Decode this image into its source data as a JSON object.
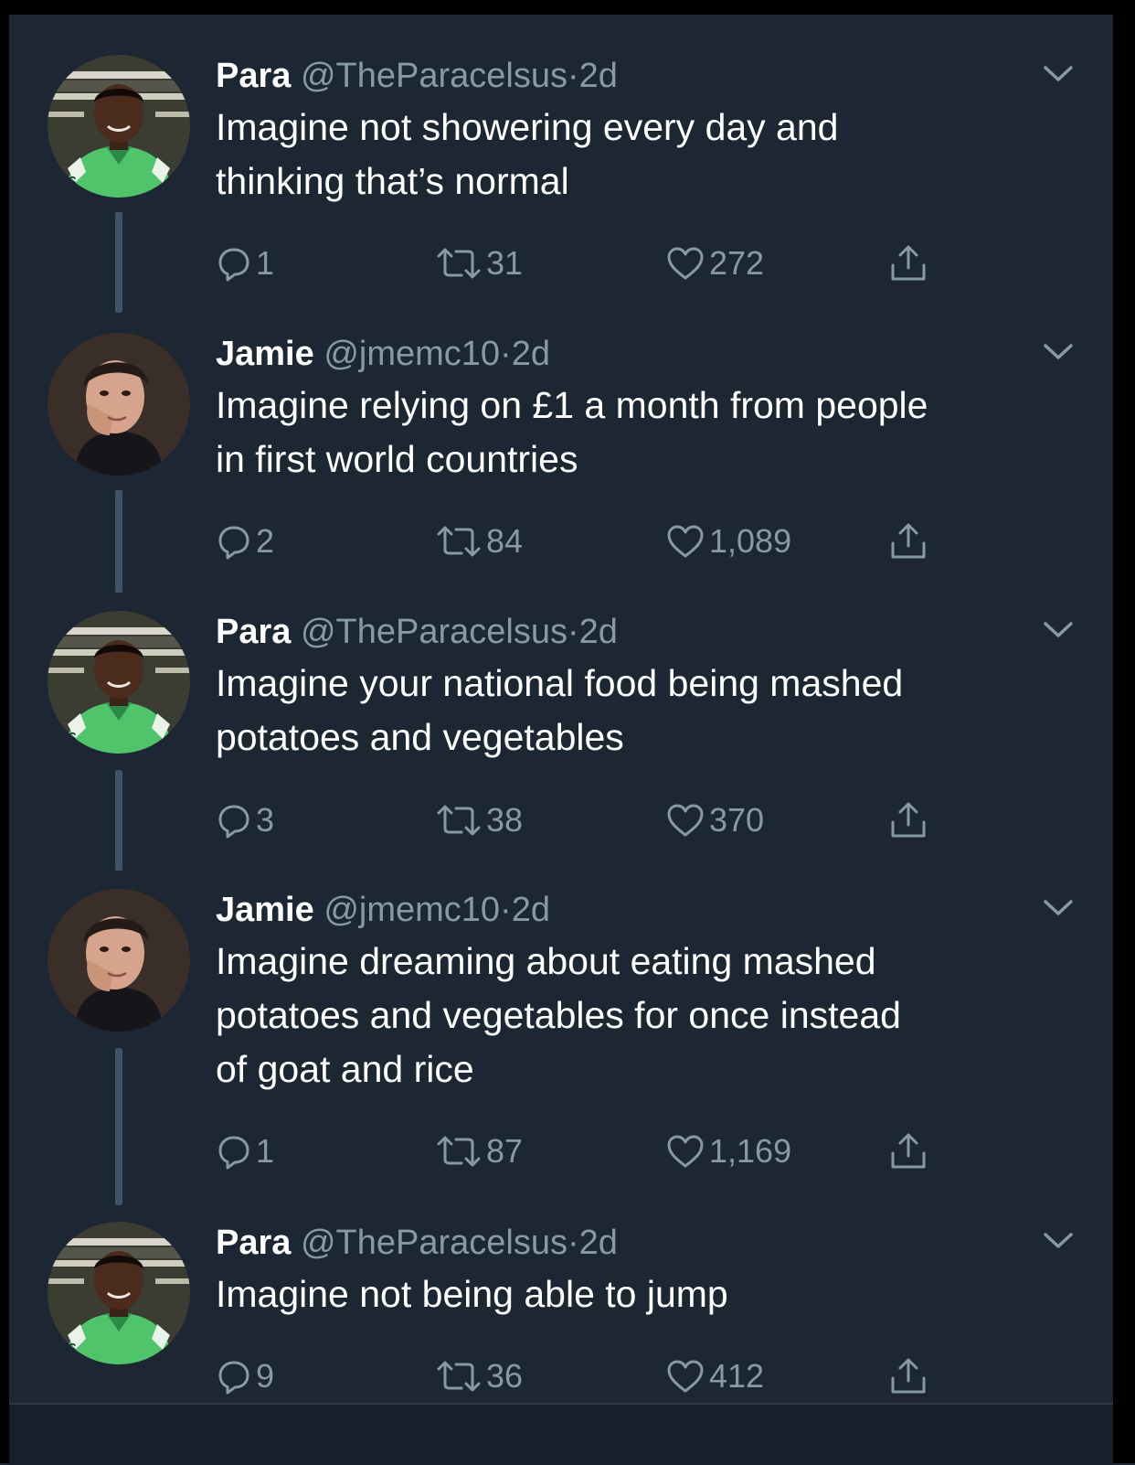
{
  "theme": {
    "background": "#1c2733",
    "text": "#ffffff",
    "muted": "#8899a6",
    "thread_line": "#3d5466"
  },
  "tweets": [
    {
      "name": "Para",
      "handle": "@TheParacelsus",
      "separator": "·",
      "time": "2d",
      "text": "Imagine not showering every day and\nthinking that’s normal",
      "replies": "1",
      "retweets": "31",
      "likes": "272",
      "avatar": "para-avatar"
    },
    {
      "name": "Jamie",
      "handle": "@jmemc10",
      "separator": "·",
      "time": "2d",
      "text": "Imagine relying on £1 a month from people\nin first world countries",
      "replies": "2",
      "retweets": "84",
      "likes": "1,089",
      "avatar": "jamie-avatar"
    },
    {
      "name": "Para",
      "handle": "@TheParacelsus",
      "separator": "·",
      "time": "2d",
      "text": "Imagine your national food being mashed\npotatoes and vegetables",
      "replies": "3",
      "retweets": "38",
      "likes": "370",
      "avatar": "para-avatar"
    },
    {
      "name": "Jamie",
      "handle": "@jmemc10",
      "separator": "·",
      "time": "2d",
      "text": "Imagine dreaming about eating mashed\npotatoes and vegetables for once instead\nof goat and rice",
      "replies": "1",
      "retweets": "87",
      "likes": "1,169",
      "avatar": "jamie-avatar"
    },
    {
      "name": "Para",
      "handle": "@TheParacelsus",
      "separator": "·",
      "time": "2d",
      "text": "Imagine not being able to jump",
      "replies": "9",
      "retweets": "36",
      "likes": "412",
      "avatar": "para-avatar"
    }
  ]
}
